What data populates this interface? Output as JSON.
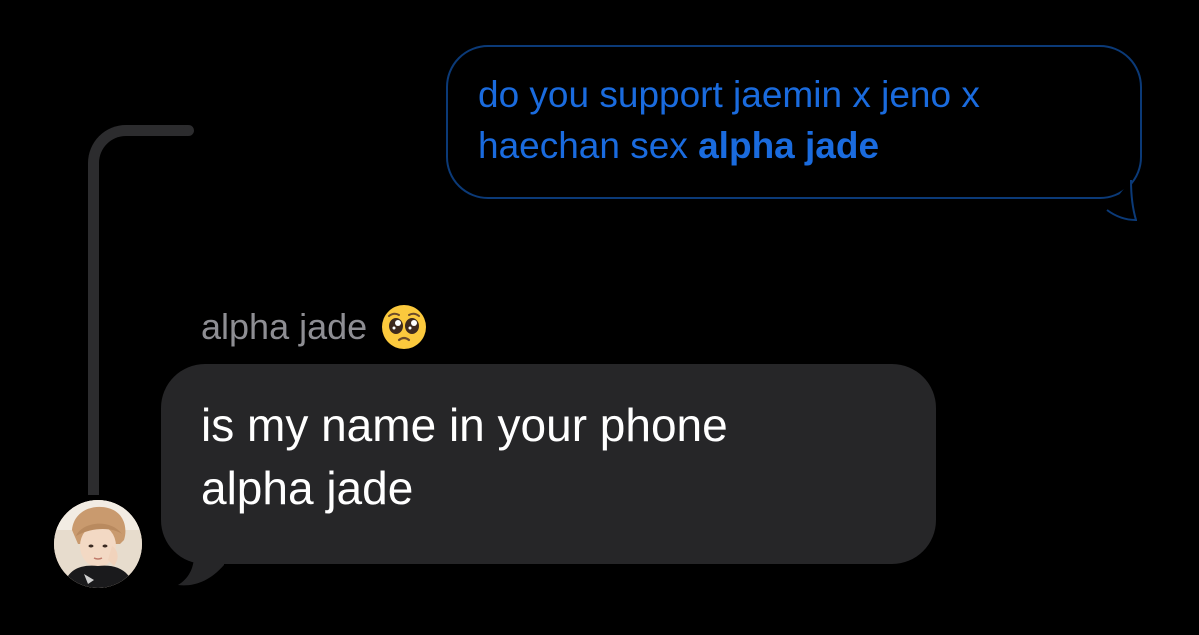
{
  "quoted_message": {
    "line1": "do you support jaemin x jeno x",
    "line2_regular": "haechan sex ",
    "line2_bold": "alpha jade"
  },
  "reply": {
    "sender_name": "alpha jade",
    "sender_emoji": "pleading-face-icon",
    "line1": "is my name in your phone",
    "line2": "alpha jade"
  },
  "avatar": {
    "icon": "contact-avatar-photo"
  },
  "colors": {
    "background": "#000000",
    "outgoing_text": "#1a6bde",
    "outgoing_border": "#0b3a78",
    "incoming_bubble": "#262628",
    "incoming_text": "#ffffff",
    "sender_name": "#8e8e93",
    "thread_line": "#2c2c2e"
  }
}
